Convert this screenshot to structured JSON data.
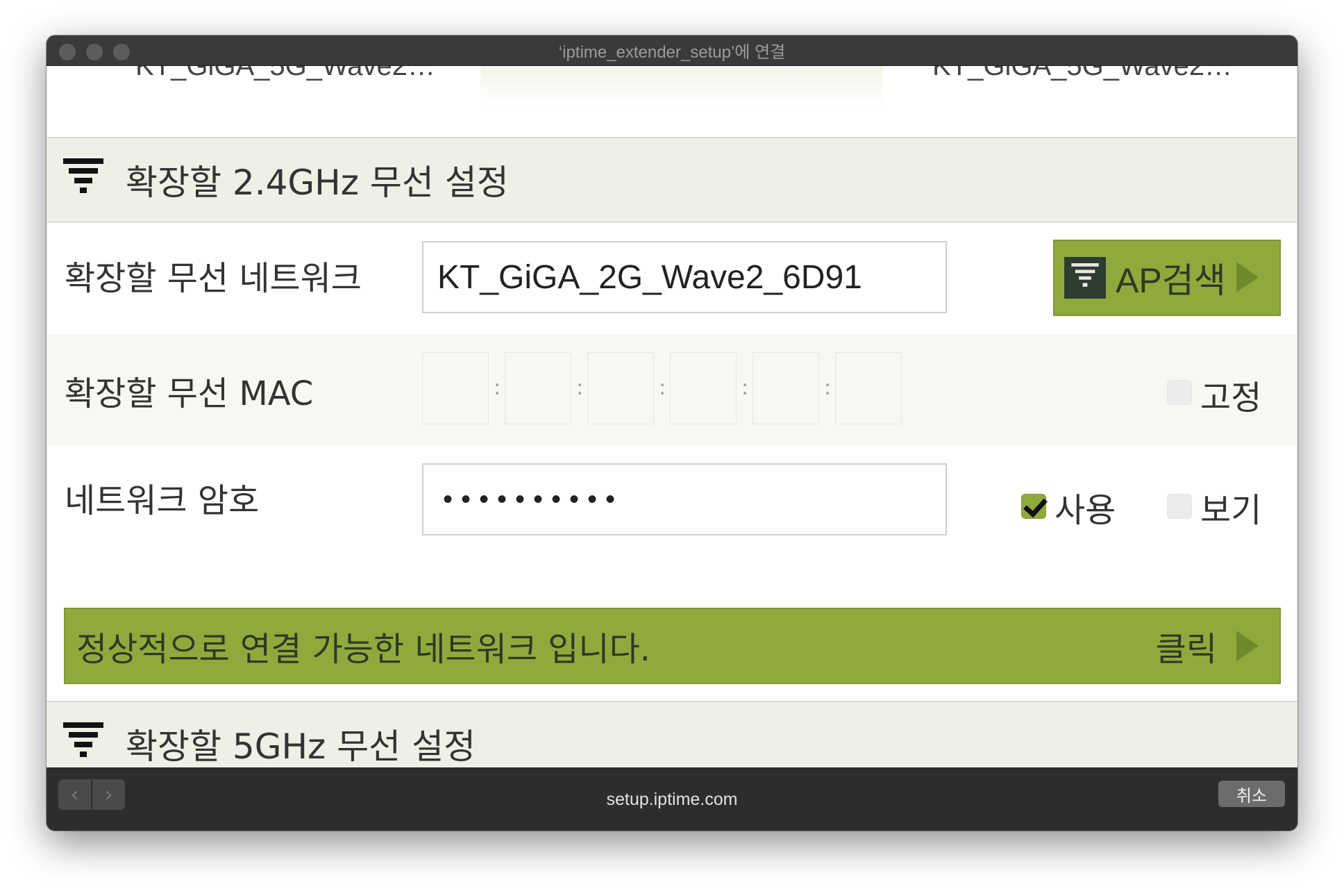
{
  "window": {
    "title": "‘iptime_extender_setup’에 연결"
  },
  "tabs": {
    "left_label": "KT_GiGA_5G_Wave2…",
    "right_label": "KT_GiGA_5G_Wave2…"
  },
  "section_24": {
    "title": "확장할 2.4GHz 무선 설정",
    "icon": "wifi-signal-icon"
  },
  "network_row": {
    "label": "확장할 무선 네트워크",
    "value": "KT_GiGA_2G_Wave2_6D91",
    "ap_button_label": "AP검색"
  },
  "mac_row": {
    "label": "확장할 무선 MAC",
    "fields": [
      "",
      "",
      "",
      "",
      "",
      ""
    ],
    "separator": ":",
    "fixed_label": "고정",
    "fixed_checked": false
  },
  "password_row": {
    "label": "네트워크 암호",
    "masked_value": "••••••••••",
    "use_label": "사용",
    "use_checked": true,
    "show_label": "보기",
    "show_checked": false
  },
  "status": {
    "message": "정상적으로 연결 가능한 네트워크 입니다.",
    "click_label": "클릭"
  },
  "section_5g": {
    "title": "확장할 5GHz 무선 설정",
    "icon": "wifi-signal-icon"
  },
  "bottom_bar": {
    "url": "setup.iptime.com",
    "cancel_label": "취소",
    "back_icon": "chevron-left-icon",
    "forward_icon": "chevron-right-icon"
  },
  "colors": {
    "accent_green": "#8faa3c",
    "section_bg": "#eef0e6",
    "titlebar": "#3a3a3a"
  }
}
